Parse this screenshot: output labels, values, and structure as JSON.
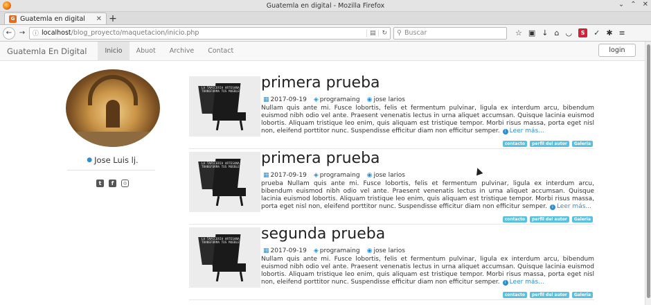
{
  "window": {
    "title": "Guatemla en digital - Mozilla Firefox"
  },
  "tab": {
    "title": "Guatemla en digital"
  },
  "address": {
    "host": "localhost",
    "path": "/blog_proyecto/maquetacion/inicio.php"
  },
  "search": {
    "placeholder": "Buscar"
  },
  "site": {
    "brand": "Guatemla En Digital",
    "menu": [
      "Inicio",
      "Abuot",
      "Archive",
      "Contact"
    ],
    "login": "login"
  },
  "profile": {
    "name": "Jose Luis lj."
  },
  "posts": [
    {
      "title": "primera prueba",
      "date": "2017-09-19",
      "category": "programaing",
      "author": "jose larios",
      "body": "Nullam quis ante mi. Fusce lobortis, felis et fermentum pulvinar, ligula ex interdum arcu, bibendum euismod nibh odio vel ante. Praesent venenatis lectus in urna aliquet accumsan. Quisque lacinia euismod lobortis. Aliquam tristique leo enim, quis aliquam est tristique tempor. Morbi risus massa, porta eget nisl non, eleifend porttitor nunc. Suspendisse efficitur diam non efficitur semper.",
      "more": "Leer más...",
      "tags": [
        "contacto",
        "perfil del autor",
        "Galeria"
      ]
    },
    {
      "title": "primera prueba",
      "date": "2017-09-19",
      "category": "programaing",
      "author": "jose larios",
      "body": "prueba Nullam quis ante mi. Fusce lobortis, felis et fermentum pulvinar, ligula ex interdum arcu, bibendum euismod nibh odio vel ante. Praesent venenatis lectus in urna aliquet accumsan. Quisque lacinia euismod lobortis. Aliquam tristique leo enim, quis aliquam est tristique tempor. Morbi risus massa, porta eget nisl non, eleifend porttitor nunc. Suspendisse efficitur diam non efficitur semper.",
      "more": "Leer más...",
      "tags": [
        "contacto",
        "perfil del autor",
        "Galeria"
      ]
    },
    {
      "title": "segunda prueba",
      "date": "2017-09-19",
      "category": "programaing",
      "author": "jose larios",
      "body": "Nullam quis ante mi. Fusce lobortis, felis et fermentum pulvinar, ligula ex interdum arcu, bibendum euismod nibh odio vel ante. Praesent venenatis lectus in urna aliquet accumsan. Quisque lacinia euismod lobortis. Aliquam tristique leo enim, quis aliquam est tristique tempor. Morbi risus massa, porta eget nisl non, eleifend porttitor nunc. Suspendisse efficitur diam non efficitur semper.",
      "more": "Leer más...",
      "tags": [
        "contacto",
        "perfil del autor",
        "Galeria"
      ]
    }
  ],
  "thumb_text": "LA TAPICERIA ARTESANA QUE TRANSFORMA TUS MUEBLES",
  "colors": {
    "accent": "#2e8ecf",
    "tag": "#5bc0de"
  }
}
